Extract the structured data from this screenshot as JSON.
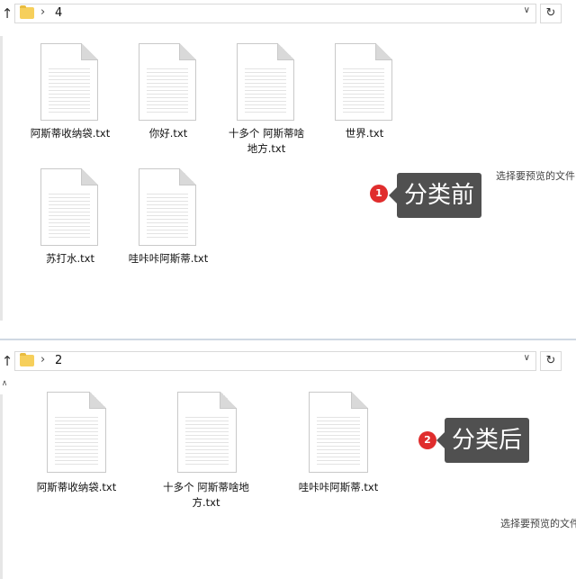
{
  "before": {
    "path": "4",
    "files": [
      {
        "name": "阿斯蒂收纳袋.txt"
      },
      {
        "name": "你好.txt"
      },
      {
        "name": "十多个 阿斯蒂啥\n地方.txt"
      },
      {
        "name": "世界.txt"
      },
      {
        "name": "苏打水.txt"
      },
      {
        "name": "哇咔咔阿斯蒂.txt"
      }
    ],
    "preview_hint": "选择要预览的文件",
    "badge": "1",
    "callout": "分类前"
  },
  "after": {
    "path": "2",
    "files": [
      {
        "name": "阿斯蒂收纳袋.txt"
      },
      {
        "name": "十多个 阿斯蒂啥地\n方.txt"
      },
      {
        "name": "哇咔咔阿斯蒂.txt"
      }
    ],
    "preview_hint": "选择要预览的文件",
    "badge": "2",
    "callout": "分类后"
  },
  "icons": {
    "up": "↑",
    "sep": "›",
    "dropdown": "∨",
    "refresh": "↻"
  }
}
